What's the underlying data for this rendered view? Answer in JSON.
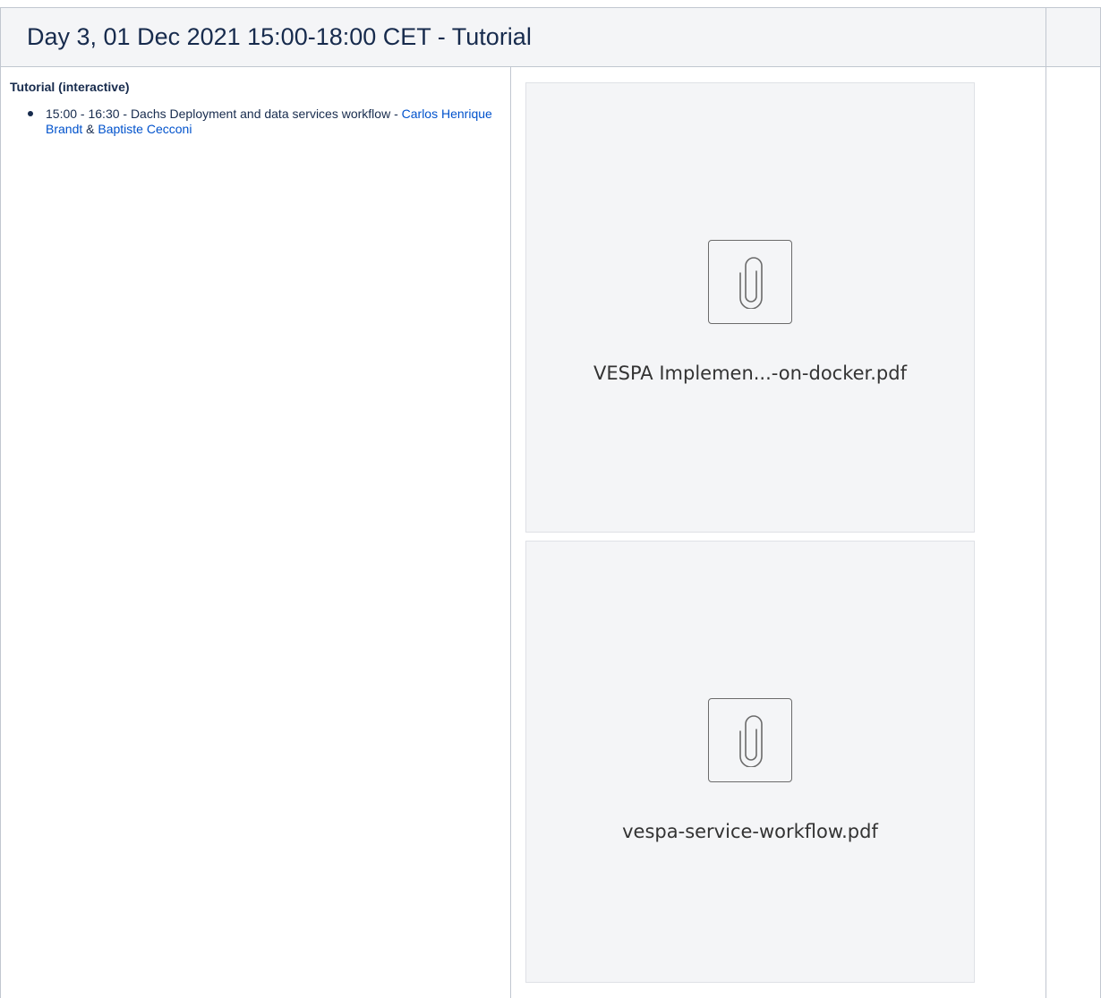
{
  "header": {
    "title": "Day 3, 01 Dec 2021  15:00-18:00 CET - Tutorial"
  },
  "session": {
    "heading": "Tutorial (interactive)",
    "items": [
      {
        "time_and_title": "15:00 - 16:30 - Dachs Deployment and data services workflow - ",
        "presenter_1": "Carlos Henrique Brandt",
        "separator": " & ",
        "presenter_2": "Baptiste Cecconi"
      }
    ]
  },
  "attachments": [
    {
      "icon": "paperclip-icon",
      "filename": "VESPA Implemen...-on-docker.pdf"
    },
    {
      "icon": "paperclip-icon",
      "filename": "vespa-service-workflow.pdf"
    }
  ],
  "colors": {
    "header_bg": "#f4f5f7",
    "border": "#c1c7d0",
    "link": "#0052cc",
    "text": "#172b4d",
    "attachment_bg": "#f4f5f7"
  }
}
